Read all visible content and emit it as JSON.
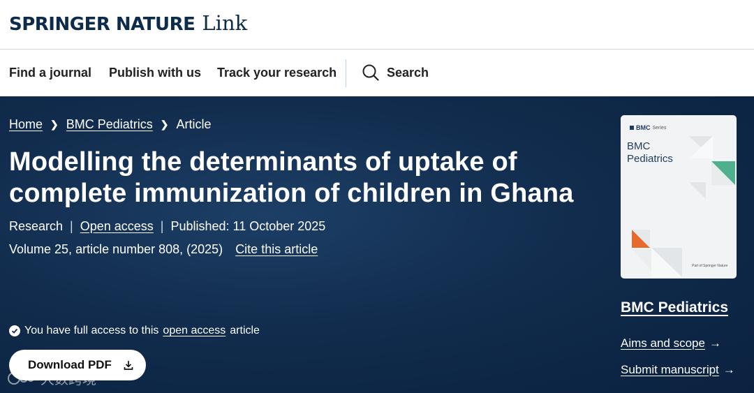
{
  "brand": {
    "main": "SPRINGER NATURE",
    "sub": "Link"
  },
  "nav": {
    "items": [
      "Find a journal",
      "Publish with us",
      "Track your research"
    ],
    "search_label": "Search"
  },
  "breadcrumb": {
    "home": "Home",
    "journal": "BMC Pediatrics",
    "current": "Article"
  },
  "article": {
    "title": "Modelling the determinants of uptake of complete immunization of children in Ghana",
    "type": "Research",
    "access": "Open access",
    "published": "Published: 11 October 2025",
    "volume": "Volume 25, article number 808, (2025)",
    "cite": "Cite this article"
  },
  "access_note": {
    "prefix": "You have full access to this",
    "link": "open access",
    "suffix": "article"
  },
  "download": {
    "label": "Download PDF",
    "icon": "download-icon"
  },
  "journal": {
    "cover_brand": "BMC",
    "cover_series": "Series",
    "cover_title_1": "BMC",
    "cover_title_2": "Pediatrics",
    "cover_footer": "Part of Springer Nature",
    "name": "BMC Pediatrics",
    "aims": "Aims and scope",
    "submit": "Submit manuscript"
  },
  "watermark": "大数跨境",
  "colors": {
    "hero": "#112c4d",
    "brand": "#0d2c4b",
    "cover_green": "#4fb08d",
    "cover_orange": "#e8692c"
  }
}
